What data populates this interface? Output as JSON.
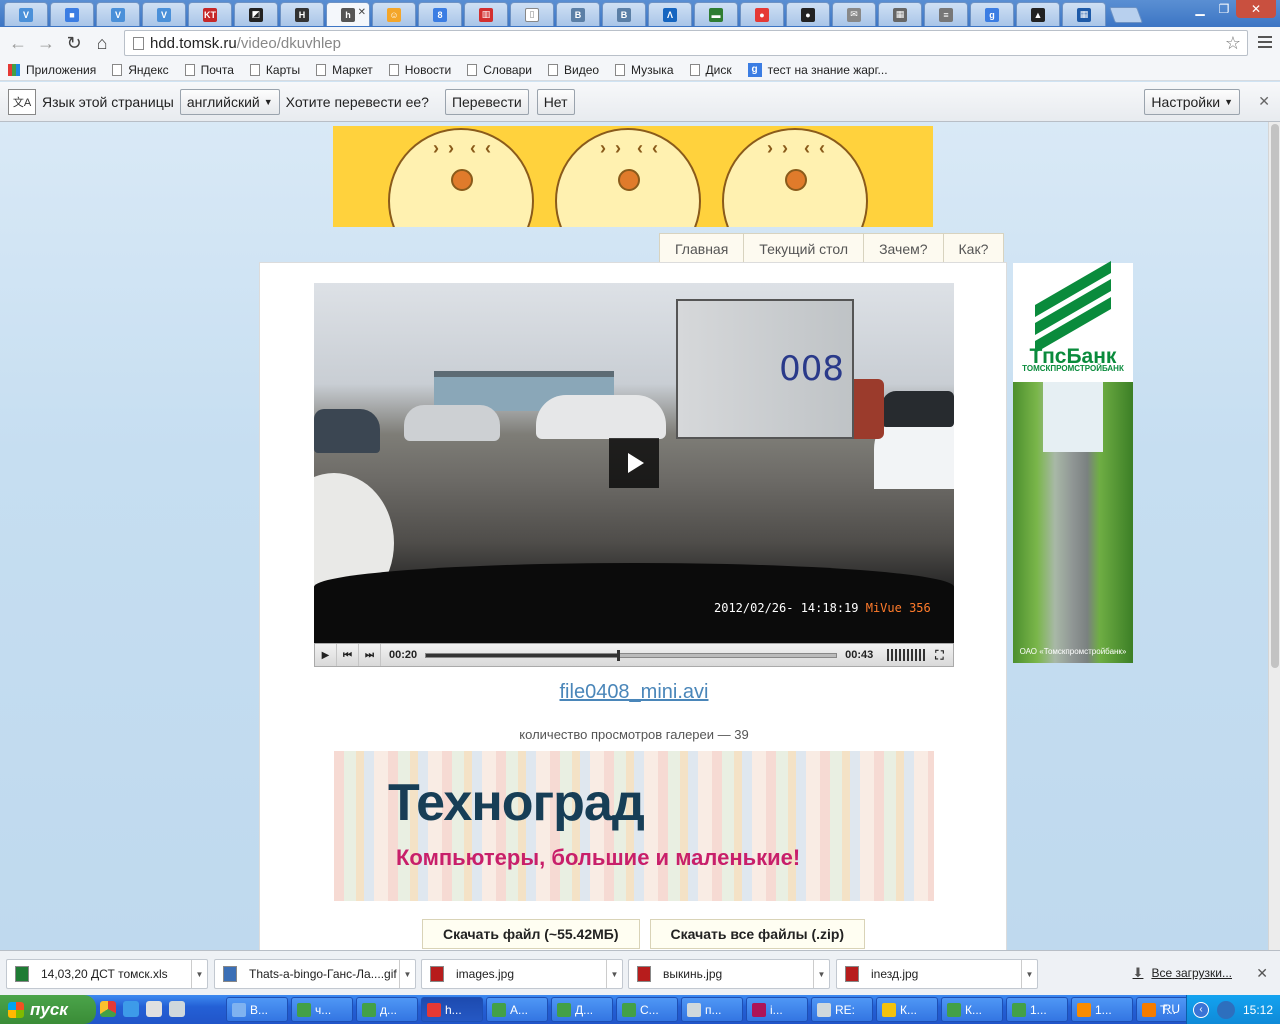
{
  "browser": {
    "tabs": [
      {
        "icon": "v-letter-icon",
        "color": "#4a90d9",
        "glyph": "V"
      },
      {
        "icon": "chat-icon",
        "color": "#3b7de3",
        "glyph": "■"
      },
      {
        "icon": "v-letter-icon",
        "color": "#4a90d9",
        "glyph": "V"
      },
      {
        "icon": "v-letter-icon",
        "color": "#4a90d9",
        "glyph": "V"
      },
      {
        "icon": "kt-logo-icon",
        "color": "#c62828",
        "glyph": "KT"
      },
      {
        "icon": "diagonal-icon",
        "color": "#222222",
        "glyph": "◩"
      },
      {
        "icon": "honda-icon",
        "color": "#333333",
        "glyph": "H"
      },
      {
        "icon": "h-letter-icon",
        "color": "#555555",
        "glyph": "h",
        "active": true
      },
      {
        "icon": "smiley-icon",
        "color": "#f4a62a",
        "glyph": "☺"
      },
      {
        "icon": "drop-icon",
        "color": "#3b7de3",
        "glyph": "8"
      },
      {
        "icon": "chart-icon",
        "color": "#d32f2f",
        "glyph": "▥"
      },
      {
        "icon": "page-icon",
        "color": "#ffffff",
        "glyph": "▯"
      },
      {
        "icon": "vk-icon",
        "color": "#5b7fa6",
        "glyph": "B"
      },
      {
        "icon": "vk-icon",
        "color": "#5b7fa6",
        "glyph": "B"
      },
      {
        "icon": "a-logo-icon",
        "color": "#1565c0",
        "glyph": "Λ"
      },
      {
        "icon": "money-icon",
        "color": "#2e7d32",
        "glyph": "▬"
      },
      {
        "icon": "red-circle-icon",
        "color": "#e53935",
        "glyph": "●"
      },
      {
        "icon": "puck-icon",
        "color": "#222222",
        "glyph": "●"
      },
      {
        "icon": "mail-icon",
        "color": "#888888",
        "glyph": "✉"
      },
      {
        "icon": "building-icon",
        "color": "#666666",
        "glyph": "▦"
      },
      {
        "icon": "doc-icon",
        "color": "#777777",
        "glyph": "≡"
      },
      {
        "icon": "google-icon",
        "color": "#3b7de3",
        "glyph": "g"
      },
      {
        "icon": "warning-icon",
        "color": "#222222",
        "glyph": "▲"
      },
      {
        "icon": "building-icon",
        "color": "#1e5aa8",
        "glyph": "▦"
      }
    ],
    "url_host": "hdd.tomsk.ru",
    "url_path": "/video/dkuvhlep",
    "bookmarks": [
      {
        "label": "Приложения",
        "kind": "apps"
      },
      {
        "label": "Яндекс",
        "kind": "page"
      },
      {
        "label": "Почта",
        "kind": "page"
      },
      {
        "label": "Карты",
        "kind": "page"
      },
      {
        "label": "Маркет",
        "kind": "page"
      },
      {
        "label": "Новости",
        "kind": "page"
      },
      {
        "label": "Словари",
        "kind": "page"
      },
      {
        "label": "Видео",
        "kind": "page"
      },
      {
        "label": "Музыка",
        "kind": "page"
      },
      {
        "label": "Диск",
        "kind": "page"
      },
      {
        "label": "тест на знание жарг...",
        "kind": "google"
      }
    ]
  },
  "translate": {
    "prompt": "Язык этой страницы",
    "language": "английский",
    "question": "Хотите перевести ее?",
    "translate_btn": "Перевести",
    "no_btn": "Нет",
    "settings_btn": "Настройки"
  },
  "site": {
    "nav": [
      "Главная",
      "Текущий стол",
      "Зачем?",
      "Как?"
    ],
    "video": {
      "stamp_date": "2012/02/26- 14:18:19",
      "stamp_brand": "MiVue 356",
      "truck_number": "008",
      "current_time": "00:20",
      "duration": "00:43",
      "progress": 0.465
    },
    "filename": "file0408_mini.avi",
    "views": "количество просмотров галереи — 39",
    "ad_tekhnograd": {
      "title": "Техноград",
      "subtitle": "Компьютеры, большие и маленькие!"
    },
    "download_btn": "Скачать файл (~55.42МБ)",
    "download_all_btn": "Скачать все файлы (.zip)",
    "side_ad": {
      "bank": "ТпсБанк",
      "bank_sub": "ТОМСКПРОМСТРОЙБАНК",
      "caption": "ОАО «Томскпромстройбанк»"
    }
  },
  "downloads": {
    "items": [
      {
        "name": "14,03,20 ДСТ томск.xls",
        "icon_color": "#1e7b34"
      },
      {
        "name": "Thats-a-bingo-Ганс-Ла....gif",
        "icon_color": "#3b6fb6"
      },
      {
        "name": "images.jpg",
        "icon_color": "#b71c1c"
      },
      {
        "name": "выкинь.jpg",
        "icon_color": "#b71c1c"
      },
      {
        "name": "inезд.jpg",
        "icon_color": "#b71c1c"
      }
    ],
    "all_label": "Все загрузки..."
  },
  "taskbar": {
    "start": "пуск",
    "buttons": [
      {
        "label": "В...",
        "color": "#7fb2f0"
      },
      {
        "label": "ч...",
        "color": "#43a047"
      },
      {
        "label": "д...",
        "color": "#43a047"
      },
      {
        "label": "h...",
        "color": "#e53935",
        "active": true
      },
      {
        "label": "А...",
        "color": "#43a047"
      },
      {
        "label": "Д...",
        "color": "#43a047"
      },
      {
        "label": "С...",
        "color": "#43a047"
      },
      {
        "label": "п...",
        "color": "#cfd8dc"
      },
      {
        "label": "i...",
        "color": "#ad1457"
      },
      {
        "label": "RE:",
        "color": "#cfd8dc"
      },
      {
        "label": "К...",
        "color": "#f4c20d"
      },
      {
        "label": "К...",
        "color": "#43a047"
      },
      {
        "label": "1...",
        "color": "#43a047"
      },
      {
        "label": "1...",
        "color": "#fb8c00"
      },
      {
        "label": "Т...",
        "color": "#f57c00"
      }
    ],
    "lang": "RU",
    "clock": "15:12"
  }
}
